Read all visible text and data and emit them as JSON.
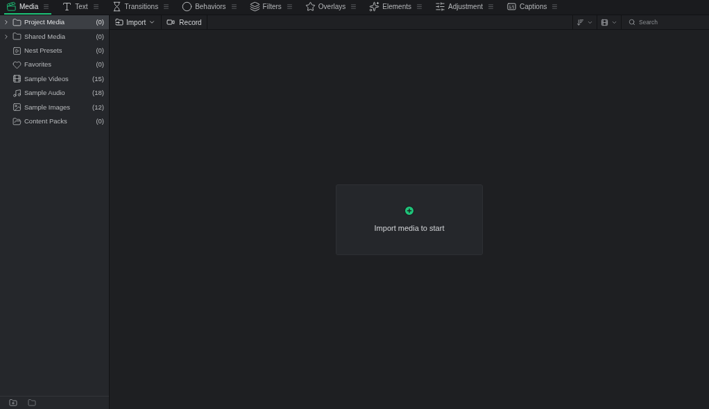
{
  "tabs": [
    {
      "label": "Media",
      "selected": true
    },
    {
      "label": "Text",
      "selected": false
    },
    {
      "label": "Transitions",
      "selected": false
    },
    {
      "label": "Behaviors",
      "selected": false
    },
    {
      "label": "Filters",
      "selected": false
    },
    {
      "label": "Overlays",
      "selected": false
    },
    {
      "label": "Elements",
      "selected": false
    },
    {
      "label": "Adjustment",
      "selected": false
    },
    {
      "label": "Captions",
      "selected": false
    }
  ],
  "sidebar": {
    "items": [
      {
        "label": "Project Media",
        "count": "(0)",
        "kind": "expandable",
        "selected": true
      },
      {
        "label": "Shared Media",
        "count": "(0)",
        "kind": "expandable",
        "selected": false
      },
      {
        "label": "Nest Presets",
        "count": "(0)",
        "kind": "plain",
        "selected": false
      },
      {
        "label": "Favorites",
        "count": "(0)",
        "kind": "plain",
        "selected": false
      },
      {
        "label": "Sample Videos",
        "count": "(15)",
        "kind": "plain",
        "selected": false
      },
      {
        "label": "Sample Audio",
        "count": "(18)",
        "kind": "plain",
        "selected": false
      },
      {
        "label": "Sample Images",
        "count": "(12)",
        "kind": "plain",
        "selected": false
      },
      {
        "label": "Content Packs",
        "count": "(0)",
        "kind": "plain",
        "selected": false
      }
    ]
  },
  "toolbar": {
    "import": "Import",
    "record": "Record",
    "search": {
      "placeholder": "Search"
    }
  },
  "empty_state": {
    "message": "Import media to start"
  }
}
